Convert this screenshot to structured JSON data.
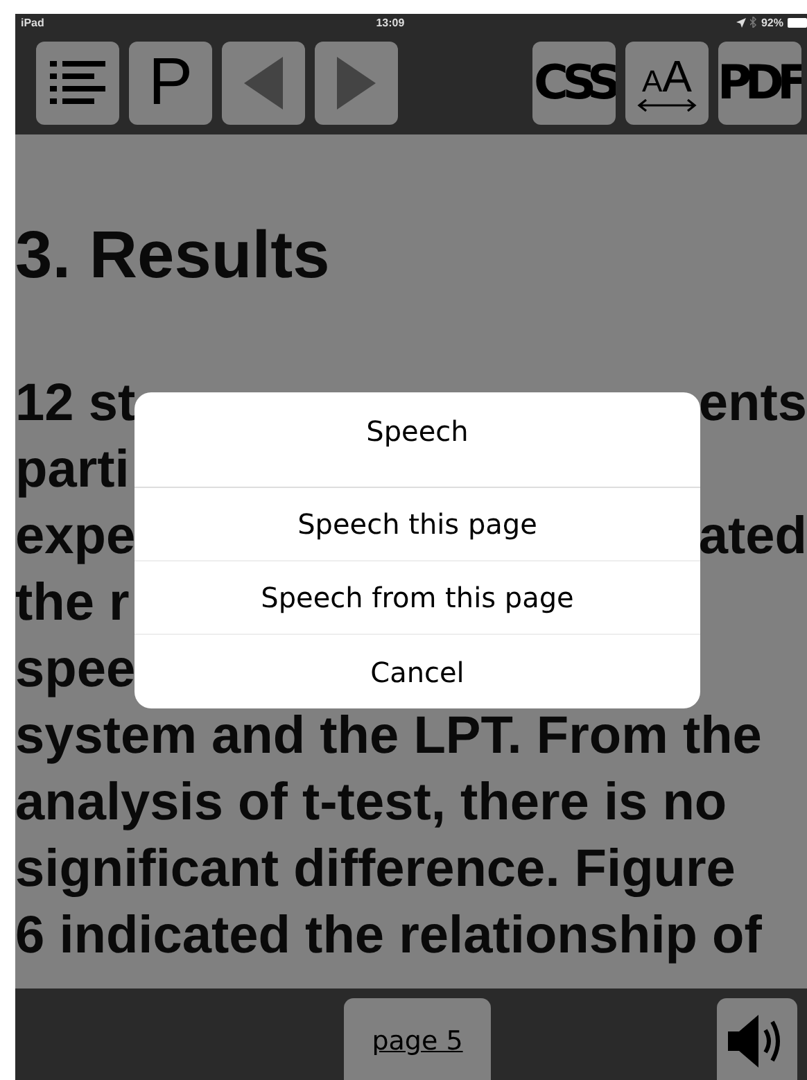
{
  "status_bar": {
    "device": "iPad",
    "time": "13:09",
    "battery": "92%"
  },
  "toolbar": {
    "left": [
      {
        "kind": "menu"
      },
      {
        "kind": "text",
        "label": "P"
      },
      {
        "kind": "prev"
      },
      {
        "kind": "next"
      }
    ],
    "right": [
      {
        "kind": "text",
        "label": "CSS"
      },
      {
        "kind": "font-size",
        "label": "AA"
      },
      {
        "kind": "text",
        "label": "PDF"
      }
    ]
  },
  "content": {
    "heading": "3. Results",
    "lines": [
      {
        "left": "12 st",
        "right": "ents"
      },
      {
        "left": "parti"
      },
      {
        "left": "expe",
        "right": "ated"
      },
      {
        "left": "the r"
      },
      {
        "left": "spee"
      },
      {
        "left": "system and the LPT. From the"
      },
      {
        "left": "analysis of t-test, there is no"
      },
      {
        "left": "significant difference. Figure"
      },
      {
        "left": "6 indicated the relationship of"
      }
    ]
  },
  "dialog": {
    "title": "Speech",
    "actions": [
      "Speech this page",
      "Speech from this page",
      "Cancel"
    ]
  },
  "bottom_bar": {
    "page_button": "page 5"
  }
}
